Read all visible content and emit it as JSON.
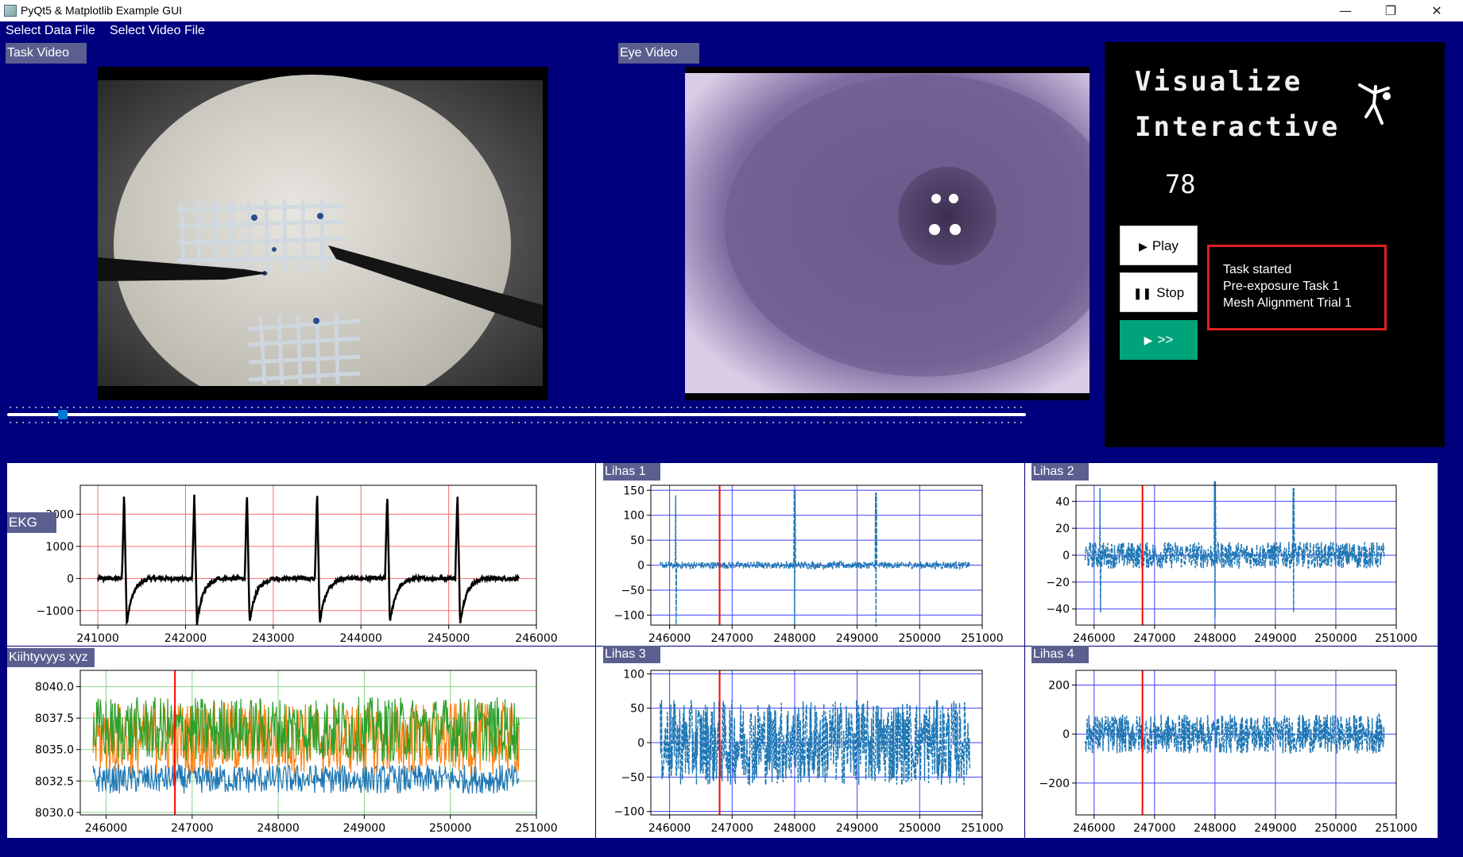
{
  "window": {
    "title": "PyQt5 & Matplotlib Example GUI",
    "minimize": "—",
    "maximize": "❐",
    "close": "✕"
  },
  "menu": {
    "items": [
      "Select Data File",
      "Select Video File"
    ]
  },
  "panels": {
    "task_video": "Task Video",
    "eye_video": "Eye Video"
  },
  "timeline": {
    "position_fraction": 0.05
  },
  "side": {
    "line1": "Visualize",
    "line2": "Interactive",
    "counter": "78",
    "figure_icon": "gymnast-icon"
  },
  "buttons": {
    "play": "Play",
    "stop": "Stop",
    "next": ">>"
  },
  "status": {
    "lines": [
      "Task started",
      "Pre-exposure Task 1",
      "Mesh Alignment Trial 1"
    ]
  },
  "colors": {
    "background": "#00007f",
    "accent": "#00a37a",
    "status_border": "#e02020",
    "series_blue": "#1f77b4",
    "series_orange": "#ff7f0e",
    "series_green": "#2ca02c",
    "cursor": "#ff0000"
  },
  "chart_data": [
    {
      "id": "ekg",
      "label": "EKG",
      "type": "line",
      "grid_color": "red",
      "color": "black",
      "xticks": [
        241000,
        242000,
        243000,
        244000,
        245000,
        246000
      ],
      "xlim": [
        240800,
        246000
      ],
      "yticks": [
        -1000,
        0,
        1000,
        2000
      ],
      "ytick_labels": [
        "−1000",
        "0",
        "1000",
        "2000"
      ],
      "ylim": [
        -1450,
        2900
      ],
      "x_range": [
        241000,
        245800
      ],
      "beats": [
        241300,
        242100,
        242700,
        243500,
        244300,
        245100
      ]
    },
    {
      "id": "lihas1",
      "label": "Lihas 1",
      "type": "line",
      "grid_color": "blue",
      "color": "#1f77b4",
      "xticks": [
        246000,
        247000,
        248000,
        249000,
        250000,
        251000
      ],
      "xlim": [
        245700,
        251000
      ],
      "yticks": [
        -100,
        -50,
        0,
        50,
        100,
        150
      ],
      "ytick_labels": [
        "−100",
        "−50",
        "0",
        "50",
        "100",
        "150"
      ],
      "ylim": [
        -120,
        160
      ],
      "x_range": [
        245850,
        250800
      ],
      "cursor_x": 246800,
      "spikes": [
        246100,
        248000,
        249300
      ],
      "spike_amp": [
        140,
        150,
        145
      ]
    },
    {
      "id": "lihas2",
      "label": "Lihas 2",
      "type": "line",
      "grid_color": "blue",
      "color": "#1f77b4",
      "xticks": [
        246000,
        247000,
        248000,
        249000,
        250000,
        251000
      ],
      "xlim": [
        245700,
        251000
      ],
      "yticks": [
        -40,
        -20,
        0,
        20,
        40
      ],
      "ytick_labels": [
        "−40",
        "−20",
        "0",
        "20",
        "40"
      ],
      "ylim": [
        -52,
        52
      ],
      "x_range": [
        245850,
        250800
      ],
      "cursor_x": 246800,
      "spikes": [
        246100,
        248000,
        249300
      ],
      "spike_amp": [
        50,
        55,
        50
      ]
    },
    {
      "id": "accel",
      "label": "Kiihtyvyys xyz",
      "type": "line",
      "grid_color": "green",
      "xticks": [
        246000,
        247000,
        248000,
        249000,
        250000,
        251000
      ],
      "xlim": [
        245700,
        251000
      ],
      "yticks": [
        8030.0,
        8032.5,
        8035.0,
        8037.5,
        8040.0
      ],
      "ytick_labels": [
        "8030.0",
        "8032.5",
        "8035.0",
        "8037.5",
        "8040.0"
      ],
      "ylim": [
        8029.8,
        8041.3
      ],
      "x_range": [
        245850,
        250800
      ],
      "cursor_x": 246800
    },
    {
      "id": "lihas3",
      "label": "Lihas 3",
      "type": "line",
      "grid_color": "blue",
      "color": "#1f77b4",
      "xticks": [
        246000,
        247000,
        248000,
        249000,
        250000,
        251000
      ],
      "xlim": [
        245700,
        251000
      ],
      "yticks": [
        -100,
        -50,
        0,
        50,
        100
      ],
      "ytick_labels": [
        "−100",
        "−50",
        "0",
        "50",
        "100"
      ],
      "ylim": [
        -105,
        105
      ],
      "x_range": [
        245850,
        250800
      ],
      "cursor_x": 246800
    },
    {
      "id": "lihas4",
      "label": "Lihas 4",
      "type": "line",
      "grid_color": "blue",
      "color": "#1f77b4",
      "xticks": [
        246000,
        247000,
        248000,
        249000,
        250000,
        251000
      ],
      "xlim": [
        245700,
        251000
      ],
      "yticks": [
        -200,
        0,
        200
      ],
      "ytick_labels": [
        "−200",
        "0",
        "200"
      ],
      "ylim": [
        -330,
        260
      ],
      "x_range": [
        245850,
        250800
      ],
      "cursor_x": 246800
    }
  ]
}
